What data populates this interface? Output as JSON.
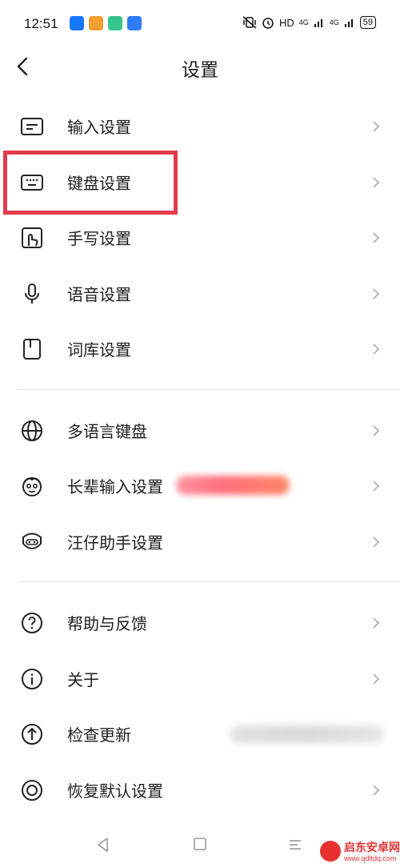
{
  "status_bar": {
    "time": "12:51",
    "network": "HD",
    "signal_1": "4G",
    "signal_2": "4G",
    "battery": "59"
  },
  "header": {
    "title": "设置"
  },
  "groups": [
    {
      "items": [
        {
          "label": "输入设置",
          "icon": "input-icon"
        },
        {
          "label": "键盘设置",
          "icon": "keyboard-icon",
          "highlighted": true
        },
        {
          "label": "手写设置",
          "icon": "handwriting-icon"
        },
        {
          "label": "语音设置",
          "icon": "microphone-icon"
        },
        {
          "label": "词库设置",
          "icon": "dictionary-icon"
        }
      ]
    },
    {
      "items": [
        {
          "label": "多语言键盘",
          "icon": "globe-icon"
        },
        {
          "label": "长辈输入设置",
          "icon": "elder-face-icon"
        },
        {
          "label": "汪仔助手设置",
          "icon": "assistant-face-icon"
        }
      ]
    },
    {
      "items": [
        {
          "label": "帮助与反馈",
          "icon": "help-icon"
        },
        {
          "label": "关于",
          "icon": "info-icon"
        },
        {
          "label": "检查更新",
          "icon": "update-icon"
        },
        {
          "label": "恢复默认设置",
          "icon": "restore-icon"
        }
      ]
    }
  ],
  "watermark": {
    "title": "启东安卓网",
    "url": "www.qdltdq.com"
  },
  "colors": {
    "highlight": "#e23b4d",
    "text": "#1e1e1e",
    "chevron": "#b0b0b0"
  }
}
